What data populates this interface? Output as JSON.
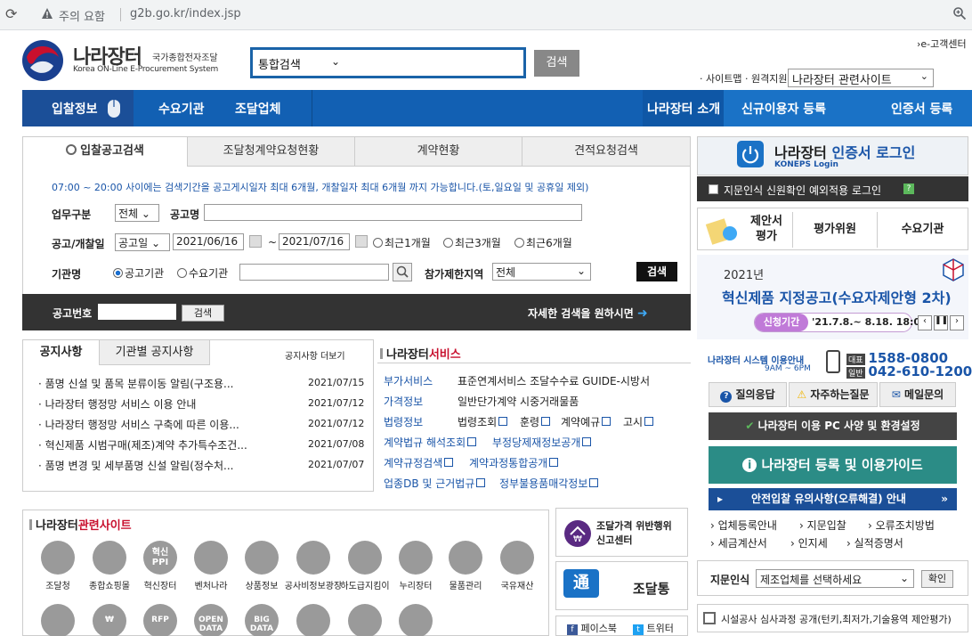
{
  "browser": {
    "warning": "주의 요함",
    "url": "g2b.go.kr/index.jsp"
  },
  "header": {
    "logo_ko": "나라장터",
    "logo_sub": "국가종합전자조달",
    "logo_en": "Korea ON-Line E-Procurement System",
    "search_scope": "통합검색",
    "search_btn": "검색",
    "ecs": "e-고객센터",
    "sitemap": "· 사이트맵 · 원격지원",
    "related_sites_select": "나라장터 관련사이트"
  },
  "nav": {
    "bid": "입찰정보",
    "agency": "수요기관",
    "vendor": "조달업체",
    "intro": "나라장터 소개",
    "register": "신규이용자 등록",
    "cert": "인증서 등록"
  },
  "tabs": [
    "입찰공고검색",
    "조달청계약요청현황",
    "계약현황",
    "견적요청검색"
  ],
  "search": {
    "notice": "07:00 ~ 20:00 사이에는 검색기간을 공고게시일자 최대 6개월, 개찰일자 최대 6개월 까지 가능합니다.(토,일요일 및 공휴일 제외)",
    "type_label": "업무구분",
    "type_value": "전체",
    "name_label": "공고명",
    "date_label": "공고/개찰일",
    "date_type": "공고일",
    "from": "2021/06/16",
    "tilde": "~",
    "to": "2021/07/16",
    "r1": "최근1개월",
    "r3": "최근3개월",
    "r6": "최근6개월",
    "org_label": "기관명",
    "org1": "공고기관",
    "org2": "수요기관",
    "region_label": "참가제한지역",
    "region_value": "전체",
    "btn": "검색",
    "no_label": "공고번호",
    "no_btn": "검색",
    "detail": "자세한 검색을 원하시면"
  },
  "notices": {
    "tab1": "공지사항",
    "tab2": "기관별 공지사항",
    "more": "공지사항 더보기",
    "items": [
      {
        "title": "· 품명 신설 및 품목 분류이동 알림(구조용...",
        "date": "2021/07/15"
      },
      {
        "title": "· 나라장터 행정망 서비스 이용 안내",
        "date": "2021/07/12"
      },
      {
        "title": "· 나라장터 행정망 서비스 구축에 따른 이용...",
        "date": "2021/07/12"
      },
      {
        "title": "· 혁신제품 시범구매(제조)계약 추가특수조건...",
        "date": "2021/07/08"
      },
      {
        "title": "· 품명 변경 및 세부품명 신설 알림(정수처...",
        "date": "2021/07/07"
      }
    ]
  },
  "services": {
    "title_a": "나라장터",
    "title_b": "서비스",
    "cat1": "부가서비스",
    "cat1_items": "표준연계서비스 조달수수료 GUIDE-시방서",
    "cat2": "가격정보",
    "cat2_items": "일반단가계약 시중거래물품",
    "cat3": "법령정보",
    "law1": "법령조회",
    "law2": "훈령",
    "law3": "계약예규",
    "law4": "고시",
    "b1": "계약법규 해석조회",
    "b2": "부정당제재정보공개",
    "b3": "계약규정검색",
    "b4": "계약과정통합공개",
    "b5": "업종DB 및 근거법규",
    "b6": "정부불용품매각정보"
  },
  "related": {
    "title_a": "나라장터",
    "title_b": "관련사이트",
    "items": [
      "조달청",
      "종합쇼핑몰",
      "혁신장터",
      "벤처나라",
      "상품정보",
      "공사비정보광장",
      "하도급지킴이",
      "누리장터",
      "물품관리",
      "국유재산"
    ],
    "icon_texts": [
      "",
      "",
      "혁신\nPPI",
      "",
      "",
      "",
      "",
      "",
      "",
      ""
    ],
    "row2_texts": [
      "",
      "₩",
      "RFP",
      "OPEN DATA",
      "BIG DATA",
      "",
      "",
      ""
    ]
  },
  "side": {
    "cert_title_a": "나라장터",
    "cert_title_b": "인증서 로그인",
    "cert_sub": "KONEPS Login",
    "bio_login": "지문인식 신원확인 예외적용 로그인",
    "proposal": "제안서 평가",
    "evaluator": "평가위원",
    "demand": "수요기관",
    "banner_year": "2021년",
    "banner_title": "혁신제품 지정공고(수요자제안형 2차)",
    "banner_tag": "신청기간",
    "banner_period": "'21.7.8.~ 8.18. 18:00",
    "help_title": "나라장터 시스템 이용안내",
    "help_hours": "9AM ~ 6PM",
    "help_rep": "대표",
    "help_rep_no": "1588-0800",
    "help_sub": "일반",
    "help_sub_no": "042-610-1200",
    "q1": "질의응답",
    "q2": "자주하는질문",
    "q3": "메일문의",
    "spec": "나라장터 이용 PC 사양 및 환경설정",
    "guide": "나라장터 등록 및 이용가이드",
    "safe": "안전입찰 유의사항(오류해결) 안내",
    "l1": "업체등록안내",
    "l2": "지문입찰",
    "l3": "오류조치방법",
    "l4": "세금계산서",
    "l5": "인지세",
    "l6": "실적증명서",
    "bio_label": "지문인식",
    "bio_select": "제조업체를 선택하세요",
    "bio_btn": "확인",
    "sisul": "시설공사 심사과정 공개(턴키,최저가,기술용역 제안평가)"
  },
  "tiles": {
    "t1a": "조달가격 위반행위",
    "t1b": "신고센터",
    "t2": "조달통",
    "t2_badge": "通",
    "fb": "페이스북",
    "tw": "트위터"
  },
  "colors": {
    "nav": "#1260b3",
    "link": "#1a55a8",
    "accent_red": "#c8102e"
  }
}
